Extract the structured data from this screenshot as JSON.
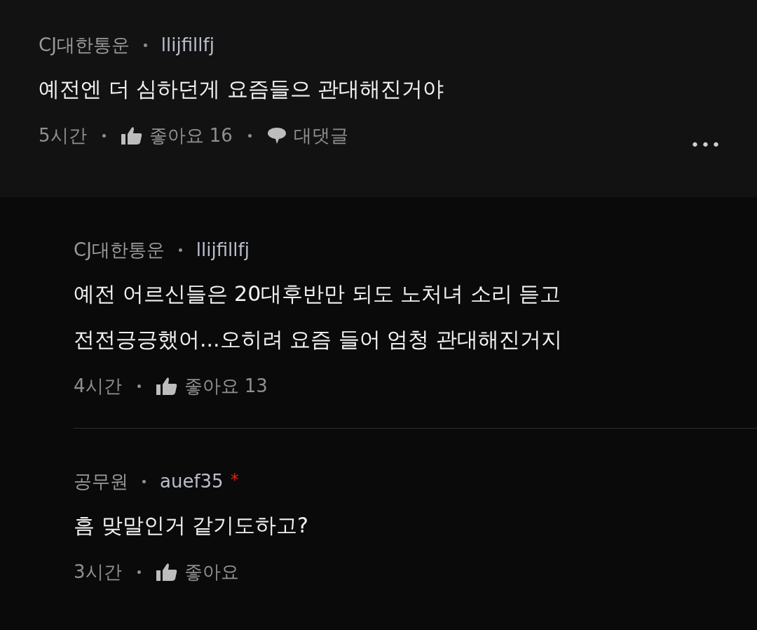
{
  "comment": {
    "nickname": "CJ대한통운",
    "user_id": "llijfillfj",
    "text": "예전엔 더 심하던게 요즘들으 관대해진거야",
    "time": "5시간",
    "like_label": "좋아요",
    "like_count": "16",
    "reply_label": "대댓글",
    "more": "•••"
  },
  "replies": [
    {
      "nickname": "CJ대한통운",
      "user_id": "llijfillfj",
      "text": "예전 어르신들은 20대후반만 되도 노처녀 소리 듣고 전전긍긍했어...오히려 요즘 들어 엄청 관대해진거지",
      "time": "4시간",
      "like_label": "좋아요",
      "like_count": "13"
    },
    {
      "nickname": "공무원",
      "user_id": "auef35",
      "flag": "*",
      "text": "흠 맞말인거 같기도하고?",
      "time": "3시간",
      "like_label": "좋아요"
    }
  ]
}
